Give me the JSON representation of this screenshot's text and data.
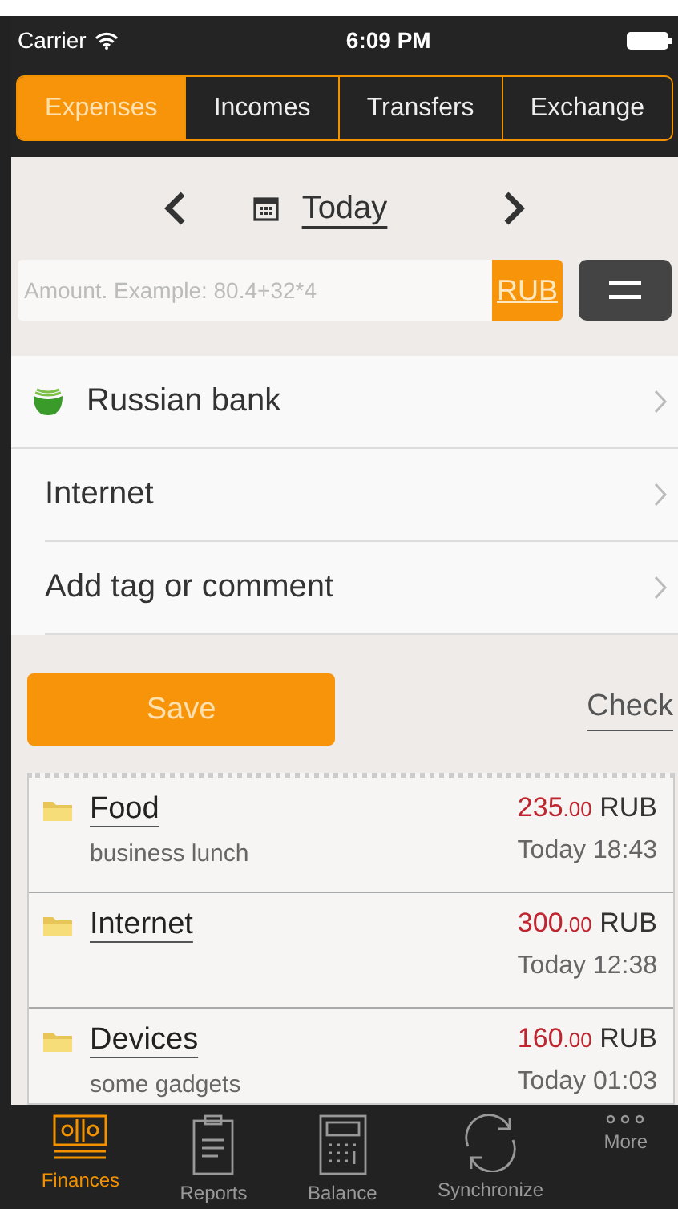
{
  "status_bar": {
    "carrier": "Carrier",
    "time": "6:09 PM"
  },
  "tabs": [
    {
      "label": "Expenses",
      "selected": true
    },
    {
      "label": "Incomes",
      "selected": false
    },
    {
      "label": "Transfers",
      "selected": false
    },
    {
      "label": "Exchange",
      "selected": false
    }
  ],
  "date_nav": {
    "label": "Today"
  },
  "amount": {
    "placeholder": "Amount. Example: 80.4+32*4",
    "currency": "RUB"
  },
  "fields": [
    {
      "label": "Russian bank",
      "kind": "account"
    },
    {
      "label": "Internet",
      "kind": "plain"
    },
    {
      "label": "Add tag or comment",
      "kind": "plain"
    }
  ],
  "save_button": "Save",
  "check_link": "Check",
  "transactions": [
    {
      "category": "Food",
      "comment": "business lunch",
      "amount": "235.00",
      "currency": "RUB",
      "day": "Today",
      "time": "18:43"
    },
    {
      "category": "Internet",
      "amount": "300.00",
      "currency": "RUB",
      "day": "Today",
      "time": "12:38"
    },
    {
      "category": "Devices",
      "comment": "some gadgets",
      "amount": "160.00",
      "currency": "RUB",
      "day": "Today",
      "time": "01:03"
    }
  ],
  "tab_bar": [
    {
      "label": "Finances",
      "kind": "money",
      "selected": true
    },
    {
      "label": "Reports",
      "kind": "clipboard",
      "selected": false
    },
    {
      "label": "Balance",
      "kind": "calculator",
      "selected": false
    },
    {
      "label": "Synchronize",
      "kind": "sync",
      "selected": false
    },
    {
      "label": "More",
      "kind": "more",
      "selected": false
    }
  ]
}
